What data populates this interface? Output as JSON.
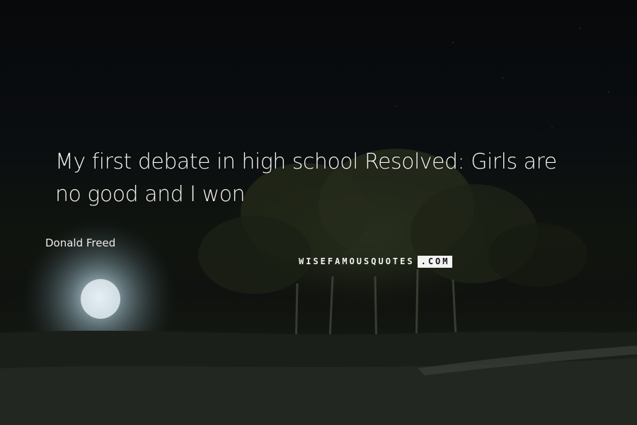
{
  "quote": {
    "line1": "My first debate in high school Resolved: Girls are",
    "line2": "no good and I won"
  },
  "author": "Donald Freed",
  "watermark": {
    "main": "WISEFAMOUSQUOTES",
    "tld": ".COM"
  },
  "colors": {
    "text": "#f4f4f2",
    "background": "#0b0d0f",
    "foliage": "#2a3020",
    "moon_glow": "#b9d2dc"
  }
}
